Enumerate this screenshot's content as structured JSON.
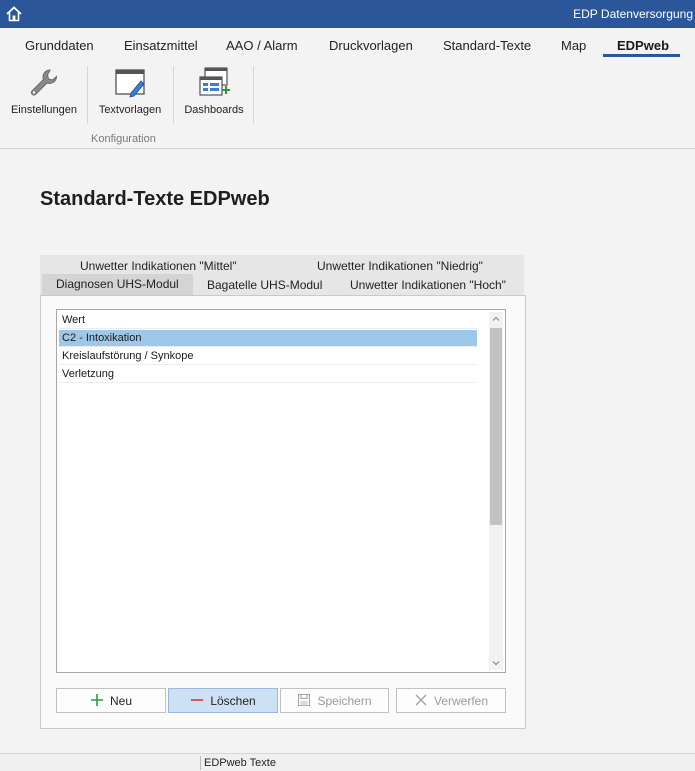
{
  "app": {
    "title": "EDP Datenversorgung",
    "home_icon": "home-icon"
  },
  "menu": {
    "items": [
      {
        "label": "Grunddaten"
      },
      {
        "label": "Einsatzmittel"
      },
      {
        "label": "AAO / Alarm"
      },
      {
        "label": "Druckvorlagen"
      },
      {
        "label": "Standard-Texte"
      },
      {
        "label": "Map"
      },
      {
        "label": "EDPweb",
        "active": true
      }
    ]
  },
  "ribbon": {
    "buttons": [
      {
        "label": "Einstellungen",
        "icon": "wrench-icon"
      },
      {
        "label": "Textvorlagen",
        "icon": "text-template-icon"
      },
      {
        "label": "Dashboards",
        "icon": "dashboard-icon"
      }
    ],
    "group_label": "Konfiguration"
  },
  "page": {
    "title": "Standard-Texte EDPweb"
  },
  "tabs": {
    "row1": [
      {
        "label": "Unwetter Indikationen \"Mittel\""
      },
      {
        "label": "Unwetter Indikationen \"Niedrig\""
      }
    ],
    "row2": [
      {
        "label": "Diagnosen UHS-Modul",
        "active": true
      },
      {
        "label": "Bagatelle UHS-Modul"
      },
      {
        "label": "Unwetter Indikationen \"Hoch\""
      }
    ]
  },
  "list": {
    "items": [
      {
        "value": "Wert"
      },
      {
        "value": "C2 - Intoxikation",
        "selected": true
      },
      {
        "value": "Kreislaufstörung / Synkope"
      },
      {
        "value": "Verletzung"
      }
    ]
  },
  "actions": {
    "new_label": "Neu",
    "delete_label": "Löschen",
    "save_label": "Speichern",
    "discard_label": "Verwerfen"
  },
  "status": {
    "text": "EDPweb Texte"
  },
  "colors": {
    "accent": "#2b579a",
    "selection": "#9ec8ea",
    "delete_active": "#cde0f5"
  }
}
